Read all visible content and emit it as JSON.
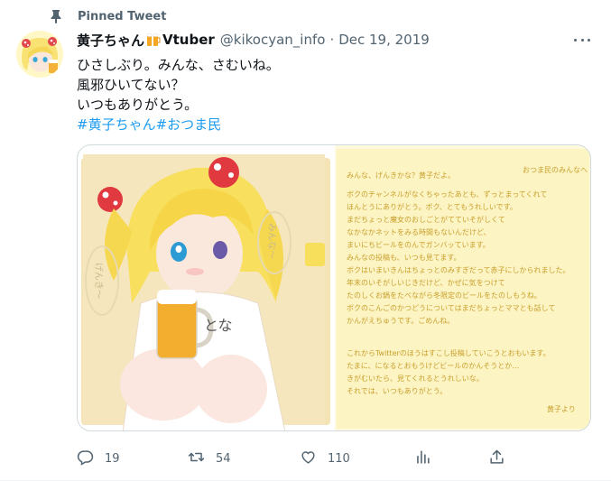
{
  "pinned": {
    "label": "Pinned Tweet"
  },
  "author": {
    "display_name": "黄子ちゃん",
    "display_name_suffix": "Vtuber",
    "handle": "@kikocyan_info",
    "separator": "·",
    "date": "Dec 19, 2019"
  },
  "tweet": {
    "lines": [
      "ひさしぶり。みんな、さむいね。",
      "風邪ひいてない？",
      "いつもありがとう。"
    ],
    "hashtags": [
      "#黄子ちゃん",
      "#おつま民"
    ]
  },
  "media": {
    "letter": {
      "header_right": "おつま民のみんなへ",
      "lines": [
        "みんな、げんきかな？黄子だよ。",
        "ボクのチャンネルがなくちゃったあとも、ずっとまってくれて",
        "ほんとうにありがとう。ボク、とてもうれしいです。",
        "まだちょっと魔女のおしごとがてていそがしくて",
        "なかなかネットをみる時間もないんだけど、",
        "まいにちビールをのんでガンバッています。",
        "みんなの投稿も、いつも見てます。",
        "ボクはいまいきんはちょっとのみすぎだって赤子にしかられました。",
        "年末のいそがしいじきだけど、かぜに気をつけて",
        "たのしくお鍋をたべながら冬限定のビールをたのしもうね。",
        "ボクのこんごのかつどうについてはまだちょっとママとも話して",
        "かんがえちゅうです。ごめんね。",
        "これからTwitterのほうはすこし投稿していこうとおもいます。",
        "たまに、になるとおもうけどビールのかんそうとか…",
        "きがむいたら、見てくれるとうれしいな。",
        "それでは、いつもありがとう。"
      ],
      "signature": "黄子より"
    },
    "art": {
      "sweater_text": "とな",
      "bubble_left": "げんき〜",
      "bubble_right": "みんな〜"
    }
  },
  "actions": {
    "reply_count": "19",
    "retweet_count": "54",
    "like_count": "110"
  },
  "icons": [
    "pin-icon",
    "beer-emoji-icon",
    "more-icon",
    "reply-icon",
    "retweet-icon",
    "like-icon",
    "views-icon",
    "share-icon"
  ],
  "colors": {
    "link": "#1d9bf0",
    "secondary_text": "#536471",
    "border": "#cfd9de"
  }
}
